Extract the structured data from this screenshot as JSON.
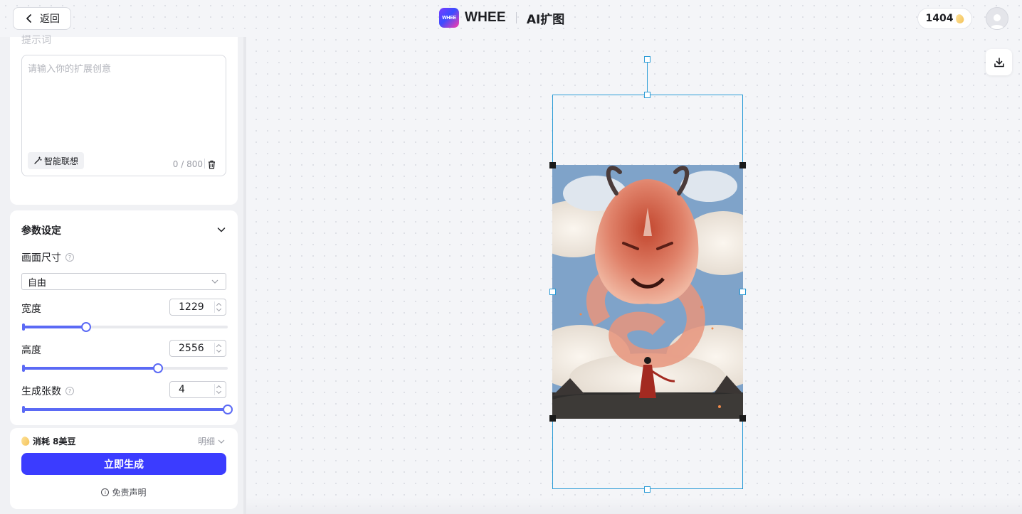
{
  "header": {
    "back_label": "返回",
    "logo_text": "WHEE",
    "brand_name": "WHEE",
    "product_name": "AI扩图",
    "credits": "1404"
  },
  "prompt": {
    "title": "提示词",
    "placeholder": "请输入你的扩展创意",
    "smart_label": "智能联想",
    "char_count": "0 / 800"
  },
  "params": {
    "title": "参数设定",
    "size_label": "画面尺寸",
    "size_value": "自由",
    "width_label": "宽度",
    "width_value": "1229",
    "height_label": "高度",
    "height_value": "2556",
    "count_label": "生成张数",
    "count_value": "4",
    "sliders": {
      "width_fraction": 0.31,
      "height_fraction": 0.66,
      "count_fraction": 1.0
    }
  },
  "generate": {
    "cost_label": "消耗 8美豆",
    "detail_label": "明细",
    "button_label": "立即生成",
    "disclaimer": "免责声明"
  },
  "colors": {
    "accent": "#3b3cff",
    "slider": "#5b6af5",
    "frame": "#2a9bd6"
  }
}
